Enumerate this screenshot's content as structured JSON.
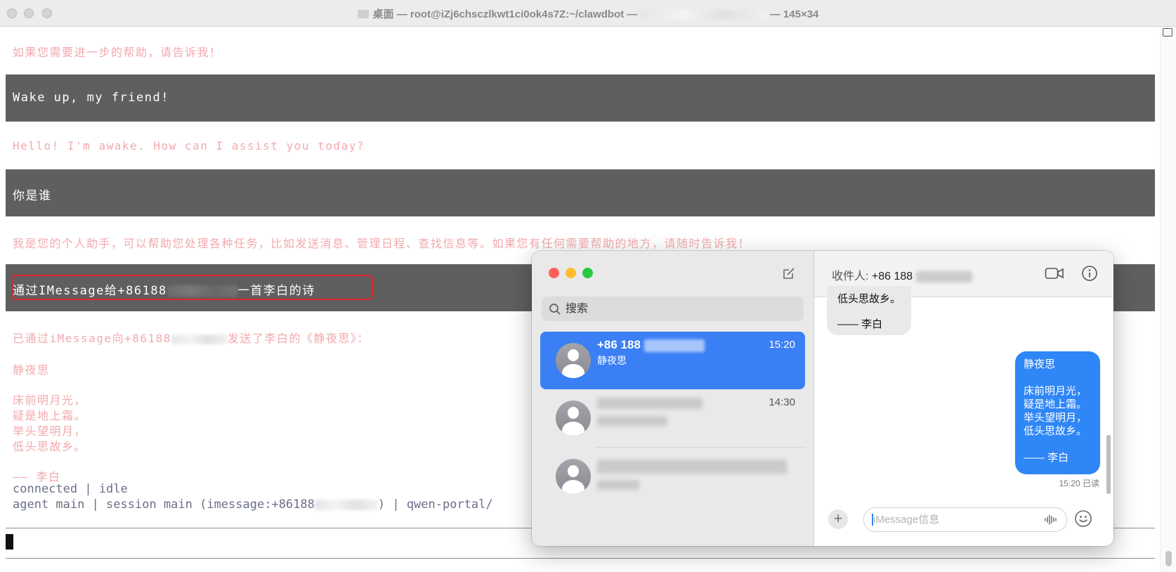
{
  "terminal": {
    "title": "桌面 — root@iZj6chsczlkwt1ci0ok4s7Z:~/clawdbot —",
    "title_suffix": "— 145×34",
    "lines": {
      "intro": "如果您需要进一步的帮助，请告诉我！",
      "user1": "Wake up, my friend!",
      "reply1": "Hello! I'm awake. How can I assist you today?",
      "user2": "你是谁",
      "reply2": "我是您的个人助手，可以帮助您处理各种任务，比如发送消息、管理日程、查找信息等。如果您有任何需要帮助的地方，请随时告诉我！",
      "user3_prefix": "通过IMessage给+86188",
      "user3_suffix": "一首李白的诗",
      "reply3_prefix": "已通过iMessage向+86188",
      "reply3_suffix": "发送了李白的《静夜思》：",
      "poem_title": "静夜思",
      "poem_1": "床前明月光，",
      "poem_2": "疑是地上霜。",
      "poem_3": "举头望明月，",
      "poem_4": "低头思故乡。",
      "poem_author": "—— 李白",
      "status_1": "connected | idle",
      "status_2_prefix": "agent main | session main (imessage:+86188",
      "status_2_suffix": ") | qwen-portal/"
    }
  },
  "messages": {
    "search_placeholder": "搜索",
    "conversations": [
      {
        "name": "+86 188",
        "preview": "静夜思",
        "time": "15:20"
      },
      {
        "name": "",
        "preview": "",
        "time": "14:30"
      },
      {
        "name": "",
        "preview": "",
        "time": ""
      }
    ],
    "header": {
      "recipient_label": "收件人:",
      "recipient": "+86 188"
    },
    "incoming": {
      "line1": "低头思故乡。",
      "line2": "—— 李白"
    },
    "outgoing": {
      "title": "静夜思",
      "lines": [
        "床前明月光，",
        "疑是地上霜。",
        "举头望明月，",
        "低头思故乡。"
      ],
      "author": "—— 李白"
    },
    "read_receipt": "15:20 已读",
    "input_placeholder": "iMessage信息"
  },
  "colors": {
    "terminal_band": "#5f5f5f",
    "pink_text": "#f3a9ad",
    "highlight": "#e0242f",
    "selected_blue": "#3b7ff5",
    "outgoing_bubble": "#2f86f6"
  }
}
